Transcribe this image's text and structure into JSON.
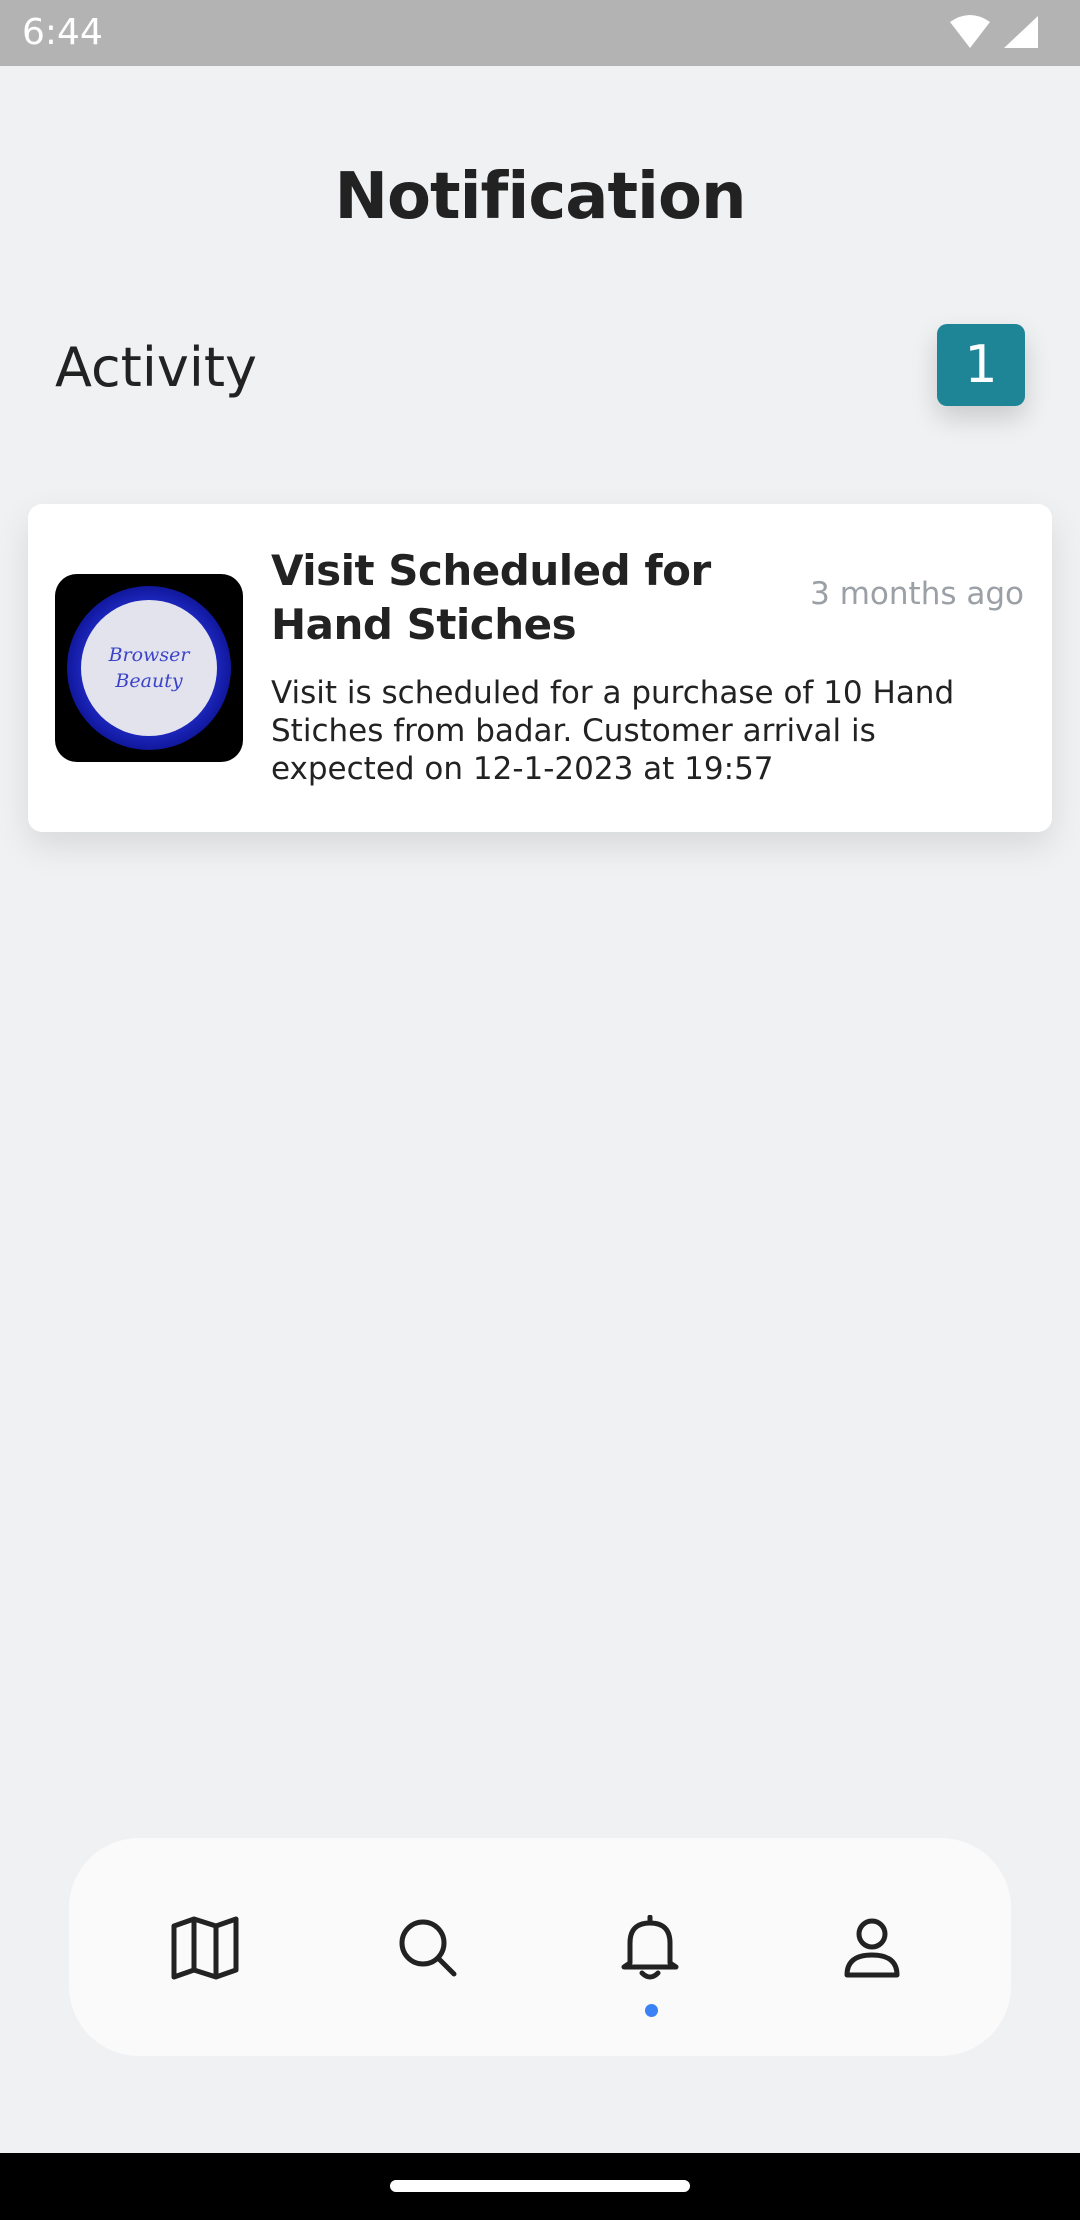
{
  "status_bar": {
    "time": "6:44",
    "icons": [
      "wifi-icon",
      "signal-icon"
    ]
  },
  "header": {
    "title": "Notification"
  },
  "activity": {
    "label": "Activity",
    "count": "1",
    "badge_color": "#1d8596"
  },
  "notifications": [
    {
      "thumbnail_text_line1": "Browser",
      "thumbnail_text_line2": "Beauty",
      "title": "Visit Scheduled for Hand Stiches",
      "time": "3 months ago",
      "body": "Visit is scheduled for a purchase of 10 Hand Stiches from badar. Customer arrival is expected on 12-1-2023 at 19:57"
    }
  ],
  "bottom_nav": {
    "items": [
      {
        "icon": "map-icon",
        "active": false
      },
      {
        "icon": "search-icon",
        "active": false
      },
      {
        "icon": "bell-icon",
        "active": true
      },
      {
        "icon": "user-icon",
        "active": false
      }
    ],
    "active_indicator_color": "#3b82f6"
  }
}
